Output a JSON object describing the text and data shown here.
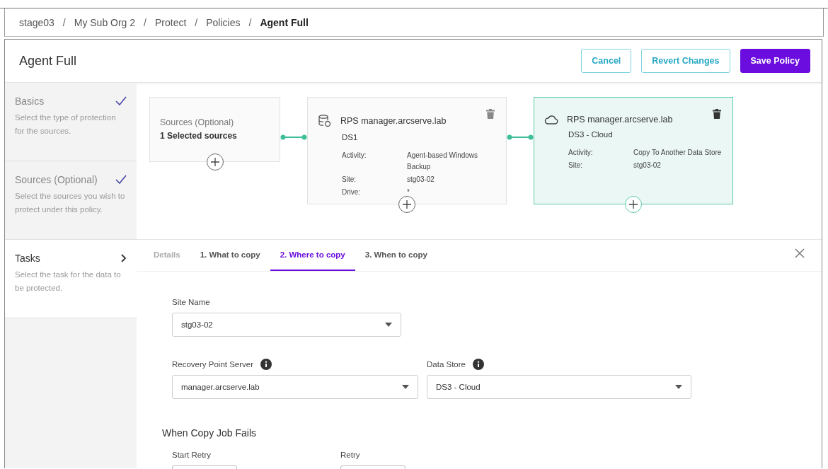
{
  "breadcrumb": [
    {
      "label": "stage03",
      "current": false
    },
    {
      "separator": "/",
      "label": "My Sub Org 2",
      "current": false
    },
    {
      "separator": "/",
      "label": "Protect",
      "current": false
    },
    {
      "separator": "/",
      "label": "Policies",
      "current": false
    },
    {
      "separator": "/",
      "label": "Agent Full",
      "current": true
    }
  ],
  "header": {
    "title": "Agent Full",
    "buttons": [
      {
        "label": "Cancel",
        "kind": "outline"
      },
      {
        "label": "Revert Changes",
        "kind": "outline"
      },
      {
        "label": "Save Policy",
        "kind": "primary"
      }
    ]
  },
  "steps": [
    {
      "title": "Basics",
      "description": "Select the type of protection for the sources.",
      "completed": true,
      "selected": false
    },
    {
      "title": "Sources (Optional)",
      "description": "Select the sources you wish to protect under this policy.",
      "completed": true,
      "selected": false
    },
    {
      "title": "Tasks",
      "description": "Select the task for the data to be protected.",
      "completed": false,
      "selected": true
    }
  ],
  "nodes": [
    {
      "kind": "sources",
      "title": "Sources (Optional)",
      "subtitle": "1 Selected sources",
      "selected": false
    },
    {
      "kind": "disk_store",
      "title": "RPS manager.arcserve.lab",
      "subtitle": "DS1",
      "selected": false,
      "details": [
        {
          "label": "Activity:",
          "value": "Agent-based Windows Backup"
        },
        {
          "label": "Site:",
          "value": "stg03-02"
        },
        {
          "label": "Drive:",
          "value": "*"
        }
      ]
    },
    {
      "kind": "cloud_store",
      "title": "RPS manager.arcserve.lab",
      "subtitle": "DS3 - Cloud",
      "selected": true,
      "details": [
        {
          "label": "Activity:",
          "value": "Copy To Another Data Store"
        },
        {
          "label": "Site:",
          "value": "stg03-02"
        }
      ]
    }
  ],
  "tabs": [
    {
      "label": "Details",
      "selected": false,
      "disabled": true
    },
    {
      "label": "1. What to copy",
      "selected": false,
      "disabled": false
    },
    {
      "label": "2. Where to copy",
      "selected": true,
      "disabled": false
    },
    {
      "label": "3. When to copy",
      "selected": false,
      "disabled": false
    }
  ],
  "form": {
    "site_name": {
      "label": "Site Name",
      "value": "stg03-02"
    },
    "recovery_point_server": {
      "label": "Recovery Point Server",
      "value": "manager.arcserve.lab"
    },
    "data_store": {
      "label": "Data Store",
      "value": "DS3 - Cloud"
    },
    "section_title": "When Copy Job Fails",
    "start_retry": {
      "label": "Start Retry"
    },
    "retry": {
      "label": "Retry"
    }
  }
}
